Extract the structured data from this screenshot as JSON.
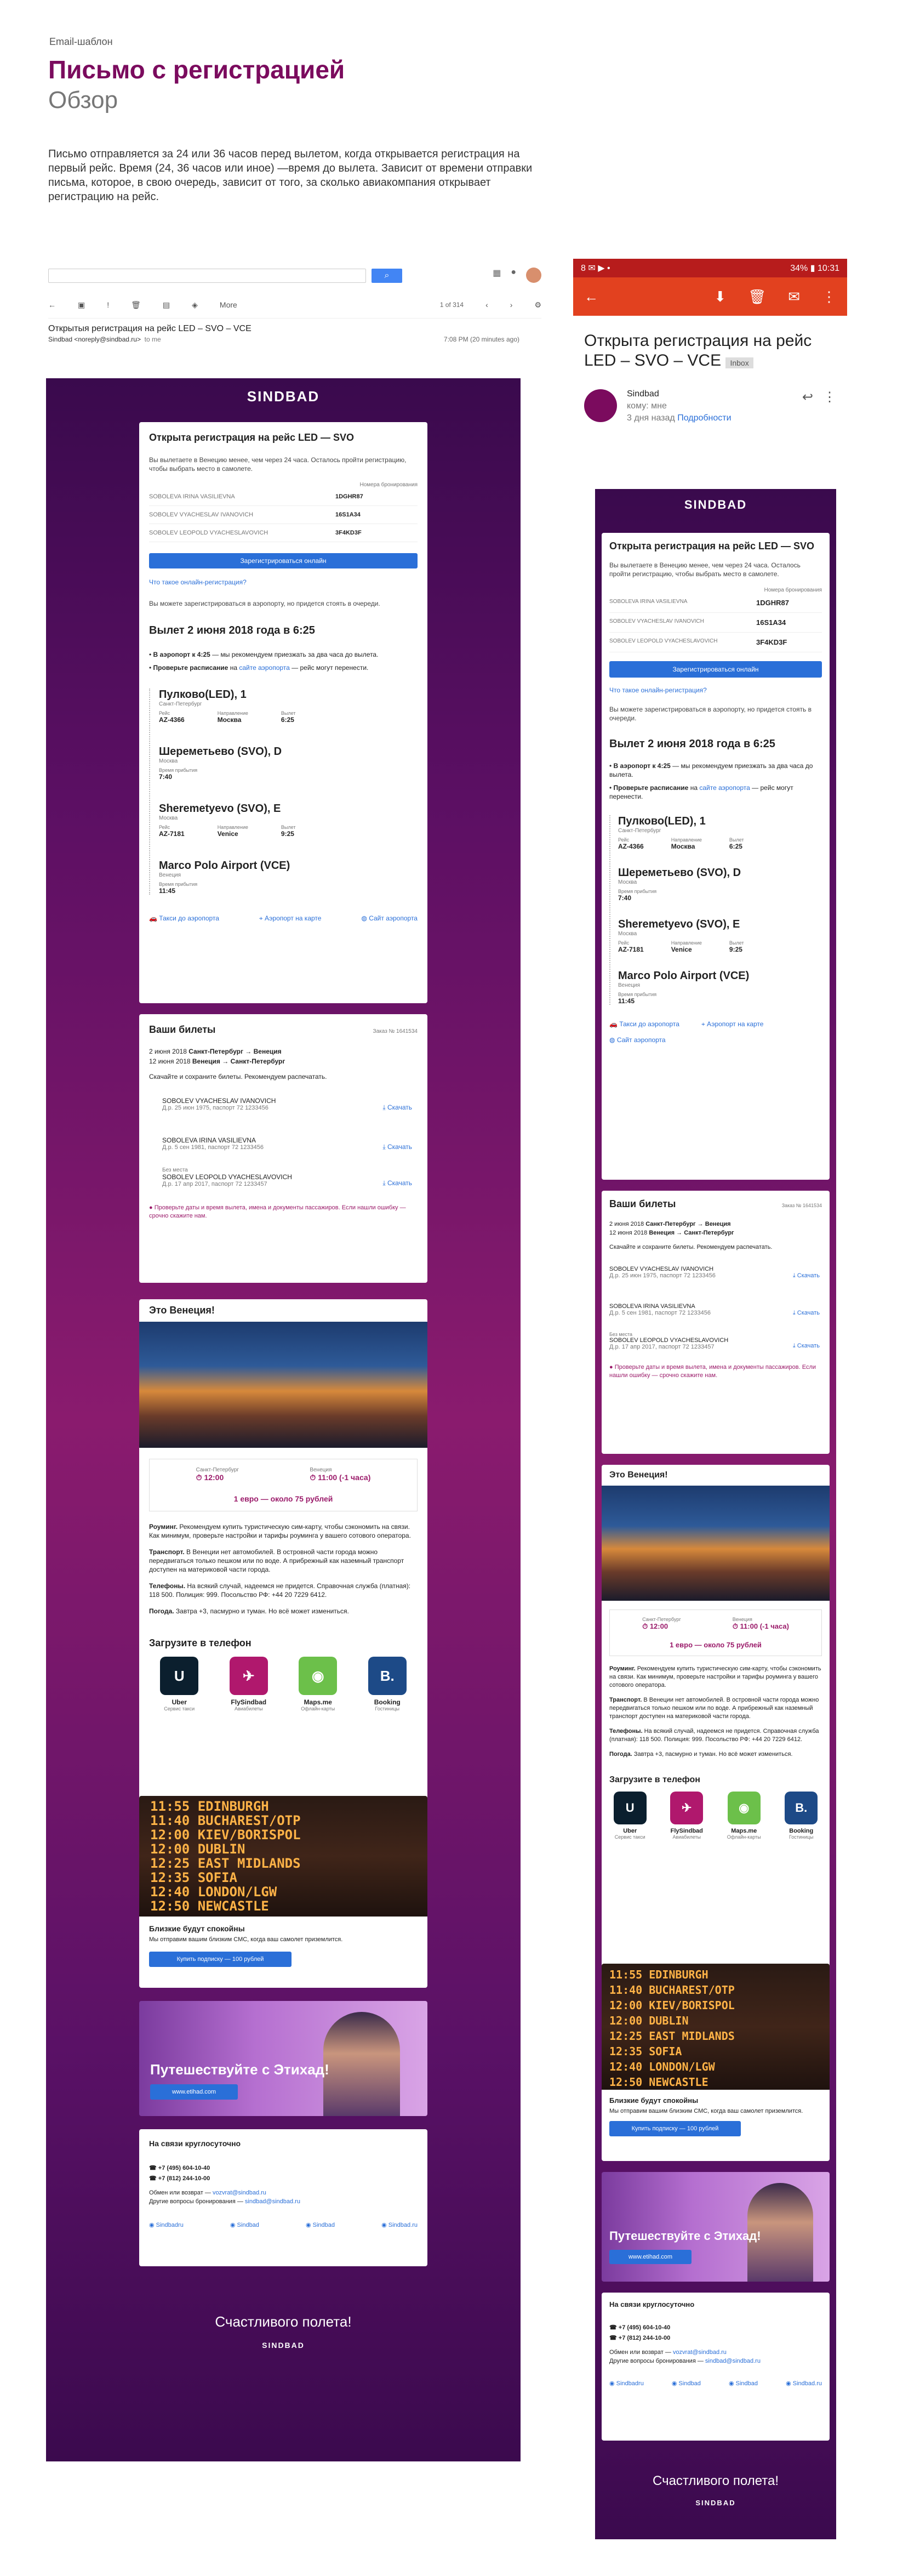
{
  "header": {
    "overline": "Email-шаблон",
    "title": "Письмо с регистрацией",
    "subtitle": "Обзор",
    "description": "Письмо отправляется за 24 или 36 часов перед вылетом, когда открывается регистрация на первый рейс. Время (24, 36 часов или иное) —время до вылета. Зависит от времени отправки письма, которое, в свою очередь, зависит от того, за сколько авиакомпания открывает регистрацию на рейс."
  },
  "gmail": {
    "subject": "Открытыя регистрация на рейс LED – SVO – VCE",
    "from": "Sindbad <noreply@sindbad.ru>",
    "to": "to me",
    "time": "7:08 PM (20 minutes ago)",
    "pager": "1 of 314",
    "more": "More"
  },
  "phone": {
    "status_time": "10:31",
    "battery": "34%",
    "subject": "Открыта регистрация на рейс LED – SVO – VCE",
    "inbox_tag": "Inbox",
    "sender": "Sindbad",
    "to": "кому: мне",
    "ago": "3 дня назад",
    "details": "Подробности"
  },
  "email": {
    "logo": "SINDBAD",
    "checkin": {
      "title": "Открыта регистрация на рейс LED — SVO",
      "intro": "Вы вылетаете в Венецию менее, чем через 24 часа. Осталось пройти регистрацию, чтобы выбрать место в самолете.",
      "booking_label": "Номера бронирования",
      "passengers": [
        {
          "name": "SOBOLEVA IRINA VASILIEVNA",
          "code": "1DGHR87"
        },
        {
          "name": "SOBOLEV VYACHESLAV IVANOVICH",
          "code": "16S1A34"
        },
        {
          "name": "SOBOLEV LEOPOLD VYACHESLAVOVICH",
          "code": "3F4KD3F"
        }
      ],
      "button": "Зарегистрироваться онлайн",
      "what_link": "Что такое онлайн-регистрация?",
      "airport_note": "Вы можете зарегистрироваться в аэропорту, но придется стоять в очереди.",
      "departure": "Вылет 2 июня 2018 года в 6:25",
      "tip1_bold": "В аэропорт к 4:25",
      "tip1": " — мы рекомендуем приезжать за два часа до вылета.",
      "tip2_bold": "Проверьте расписание",
      "tip2_mid": " на ",
      "tip2_link": "сайте аэропорта",
      "tip2_end": " — рейс могут перенести.",
      "seg1_from": "Пулково(LED), 1",
      "seg1_city": "Санкт-Петербург",
      "seg1_flight_l": "Рейс",
      "seg1_flight": "AZ-4366",
      "seg1_dest_l": "Направление",
      "seg1_dest": "Москва",
      "seg1_time_l": "Вылет",
      "seg1_time": "6:25",
      "seg1_to": "Шереметьево (SVO), D",
      "seg1_to_city": "Москва",
      "seg1_arr_l": "Время прибытия",
      "seg1_arr": "7:40",
      "seg2_from": "Sheremetyevo (SVO), E",
      "seg2_city": "Москва",
      "seg2_flight": "AZ-7181",
      "seg2_dest": "Venice",
      "seg2_time": "9:25",
      "seg2_to": "Marco Polo Airport (VCE)",
      "seg2_to_city": "Венеция",
      "seg2_arr": "11:45",
      "taxi": "Такси до аэропорта",
      "map": "Аэропорт на карте",
      "site": "Сайт аэропорта"
    },
    "tickets": {
      "title": "Ваши билеты",
      "order": "Заказ № 1641534",
      "line1_date": "2 июня 2018",
      "line1_from": "Санкт-Петербург",
      "line1_to": "Венеция",
      "line2_date": "12 июня 2018",
      "line2_from": "Венеция",
      "line2_to": "Санкт-Петербург",
      "save_note": "Скачайте и сохраните билеты. Рекомендуем распечатать.",
      "list": [
        {
          "name": "SOBOLEV VYACHESLAV IVANOVICH",
          "dob": "Д.р. 25 июн 1975",
          "pass": "паспорт 72 1233456",
          "seat": ""
        },
        {
          "name": "SOBOLEVA IRINA VASILIEVNA",
          "dob": "Д.р. 5 сен 1981",
          "pass": "паспорт 72 1233456",
          "seat": ""
        },
        {
          "name": "SOBOLEV LEOPOLD VYACHESLAVOVICH",
          "dob": "Д.р. 17 апр 2017",
          "pass": "паспорт 72 1233457",
          "seat": "Без места"
        }
      ],
      "download": "Скачать",
      "warning": "Проверьте даты и время вылета, имена и документы пассажиров. Если нашли ошибку — срочно скажите нам."
    },
    "venice": {
      "title": "Это Венеция!",
      "from_city": "Санкт-Петербург",
      "from_time": "12:00",
      "to_city": "Венеция",
      "to_time": "11:00 (-1 часа)",
      "rate": "1 евро — около 75 рублей",
      "roaming_b": "Роуминг.",
      "roaming": " Рекомендуем купить туристическую сим-карту, чтобы сэкономить на связи. Как минимум, проверьте настройки и тарифы роуминга у вашего сотового оператора.",
      "transport_b": "Транспорт.",
      "transport": " В Венеции нет автомобилей. В островной части города можно передвигаться только пешком или по воде. А прибрежный как наземный транспорт доступен на материковой части города.",
      "phones_b": "Телефоны.",
      "phones": " На всякий случай, надеемся не придется. Справочная служба (платная): 118 500. Полиция: 999. Посольство РФ: +44 20 7229 6412.",
      "weather_b": "Погода.",
      "weather": " Завтра +3, пасмурно и туман. Но всё может измениться."
    },
    "apps": {
      "title": "Загрузите в телефон",
      "items": [
        {
          "name": "Uber",
          "sub": "Сервис такси",
          "color": "#0b1f2e",
          "glyph": "U"
        },
        {
          "name": "FlySindbad",
          "sub": "Авиабилеты",
          "color": "#b0186d",
          "glyph": "✈"
        },
        {
          "name": "Maps.me",
          "sub": "Офлайн-карты",
          "color": "#6cc04a",
          "glyph": "◉"
        },
        {
          "name": "Booking",
          "sub": "Гостиницы",
          "color": "#1d4a87",
          "glyph": "B."
        }
      ]
    },
    "board": {
      "rows": [
        "EDINBURGH",
        "BUCHAREST/OTP",
        "KIEV/BORISPOL",
        "DUBLIN",
        "EAST MIDLANDS",
        "SOFIA",
        "LONDON/LGW",
        "NEWCASTLE"
      ],
      "times": [
        "11:55",
        "11:40",
        "12:00",
        "12:00",
        "12:25",
        "12:35",
        "12:40",
        "12:50"
      ]
    },
    "sms": {
      "title": "Близкие будут спокойны",
      "text": "Мы отправим вашим близким СМС, когда ваш самолет приземлится.",
      "button": "Купить подписку — 100 рублей"
    },
    "etihad": {
      "title": "Путешествуйте с Этихад!",
      "button": "www.etihad.com"
    },
    "support": {
      "title": "На связи круглосуточно",
      "phone1": "+7 (495) 604-10-40",
      "phone2": "+7 (812) 244-10-00",
      "exchange_l": "Обмен или возврат — ",
      "exchange": "vozvrat@sindbad.ru",
      "other_l": "Другие вопросы бронирования — ",
      "other": "sindbad@sindbad.ru",
      "socials": [
        "Sindbadru",
        "Sindbad",
        "Sindbad",
        "Sindbad.ru"
      ]
    },
    "footer": {
      "text": "Счастливого полета!",
      "logo": "SINDBAD"
    }
  }
}
